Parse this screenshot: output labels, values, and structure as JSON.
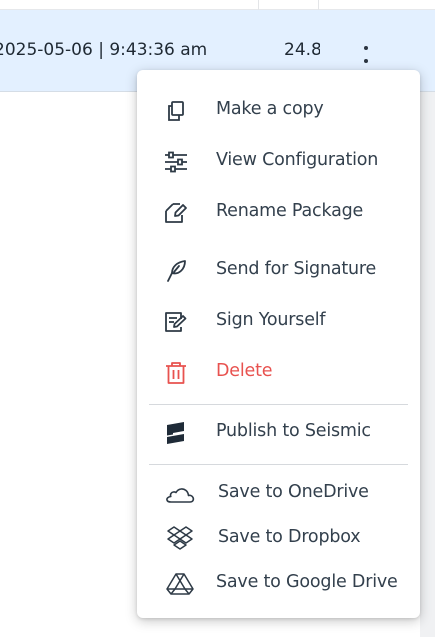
{
  "table": {
    "selected_row": {
      "date_text": "2025-05-06 | 9:43:36 am",
      "size_text": "24.8"
    }
  },
  "menu": {
    "items": [
      {
        "label": "Make a copy",
        "icon": "copy-icon"
      },
      {
        "label": "View Configuration",
        "icon": "sliders-icon"
      },
      {
        "label": "Rename Package",
        "icon": "rename-icon"
      },
      {
        "label": "Send for Signature",
        "icon": "feather-pen-icon"
      },
      {
        "label": "Sign Yourself",
        "icon": "sign-document-icon"
      },
      {
        "label": "Delete",
        "icon": "trash-icon",
        "color": "#e8524f"
      },
      {
        "label": "Publish to Seismic",
        "icon": "seismic-logo-icon"
      },
      {
        "label": "Save to OneDrive",
        "icon": "cloud-icon"
      },
      {
        "label": "Save to Dropbox",
        "icon": "dropbox-icon"
      },
      {
        "label": "Save to Google Drive",
        "icon": "google-drive-icon"
      }
    ]
  },
  "colors": {
    "selected_row_bg": "#e3f0ff",
    "text": "#33404d",
    "danger": "#e8524f"
  }
}
